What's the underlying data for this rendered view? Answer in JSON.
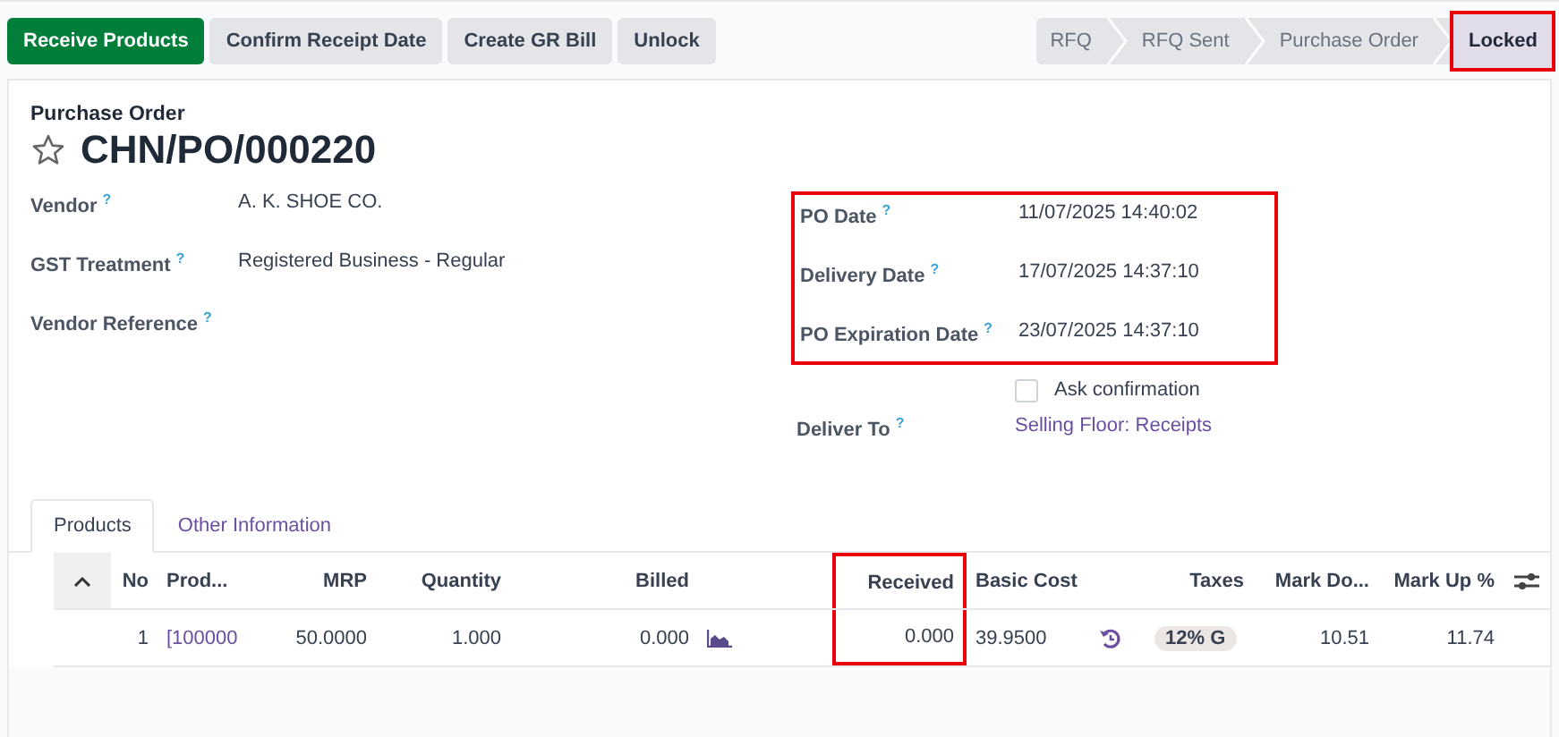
{
  "action_buttons": [
    {
      "label": "Receive Products",
      "primary": true
    },
    {
      "label": "Confirm Receipt Date",
      "primary": false
    },
    {
      "label": "Create GR Bill",
      "primary": false
    },
    {
      "label": "Unlock",
      "primary": false
    }
  ],
  "status_steps": [
    {
      "label": "RFQ",
      "selected": false,
      "highlighted": false
    },
    {
      "label": "RFQ Sent",
      "selected": false,
      "highlighted": false
    },
    {
      "label": "Purchase Order",
      "selected": false,
      "highlighted": false
    },
    {
      "label": "Locked",
      "selected": true,
      "highlighted": true
    }
  ],
  "record": {
    "type_label": "Purchase Order",
    "favorite": false,
    "name": "CHN/PO/000220"
  },
  "left_fields": [
    {
      "label": "Vendor",
      "help": "?",
      "value": "A. K. SHOE CO."
    },
    {
      "label": "GST Treatment",
      "help": "?",
      "value": "Registered Business - Regular"
    },
    {
      "label": "Vendor Reference",
      "help": "?"
    }
  ],
  "date_fields": {
    "highlighted": true,
    "items": [
      {
        "label": "PO Date",
        "help": "?",
        "value": "11/07/2025 14:40:02"
      },
      {
        "label": "Delivery Date",
        "help": "?",
        "value": "17/07/2025 14:37:10"
      },
      {
        "label": "PO Expiration Date",
        "help": "?",
        "value": "23/07/2025 14:37:10"
      }
    ]
  },
  "ask_confirmation": {
    "label": "Ask confirmation",
    "checked": false
  },
  "deliver_to": {
    "label": "Deliver To",
    "help": "?",
    "value": "Selling Floor: Receipts"
  },
  "tabs": [
    {
      "label": "Products",
      "selected": true
    },
    {
      "label": "Other Information",
      "selected": false
    }
  ],
  "table": {
    "columns": [
      {
        "kind": "sort"
      },
      {
        "kind": "text",
        "label": "No",
        "highlighted": false
      },
      {
        "kind": "text",
        "label": "Prod...",
        "highlighted": false
      },
      {
        "kind": "text",
        "label": "MRP",
        "highlighted": false
      },
      {
        "kind": "text",
        "label": "Quantity",
        "highlighted": false
      },
      {
        "kind": "text",
        "label": "Billed",
        "highlighted": false
      },
      {
        "kind": "blank"
      },
      {
        "kind": "text",
        "label": "Received",
        "highlighted": true
      },
      {
        "kind": "text",
        "label": "Basic Cost",
        "highlighted": false
      },
      {
        "kind": "blank"
      },
      {
        "kind": "text",
        "label": "Taxes",
        "highlighted": false
      },
      {
        "kind": "text",
        "label": "Mark Do...",
        "highlighted": false
      },
      {
        "kind": "text",
        "label": "Mark Up %",
        "highlighted": false
      },
      {
        "kind": "settings"
      }
    ],
    "rows": [
      {
        "cells": [
          {
            "kind": "blank"
          },
          {
            "kind": "text",
            "text": "1"
          },
          {
            "kind": "link",
            "text": "[100000"
          },
          {
            "kind": "text",
            "text": "50.0000"
          },
          {
            "kind": "text",
            "text": "1.000"
          },
          {
            "kind": "text",
            "text": "0.000"
          },
          {
            "kind": "chart"
          },
          {
            "kind": "text",
            "text": "0.000"
          },
          {
            "kind": "text",
            "text": "39.9500"
          },
          {
            "kind": "undo"
          },
          {
            "kind": "badge",
            "text": "12% G"
          },
          {
            "kind": "text",
            "text": "10.51"
          },
          {
            "kind": "text",
            "text": "11.74"
          },
          {
            "kind": "blank"
          }
        ]
      }
    ]
  }
}
